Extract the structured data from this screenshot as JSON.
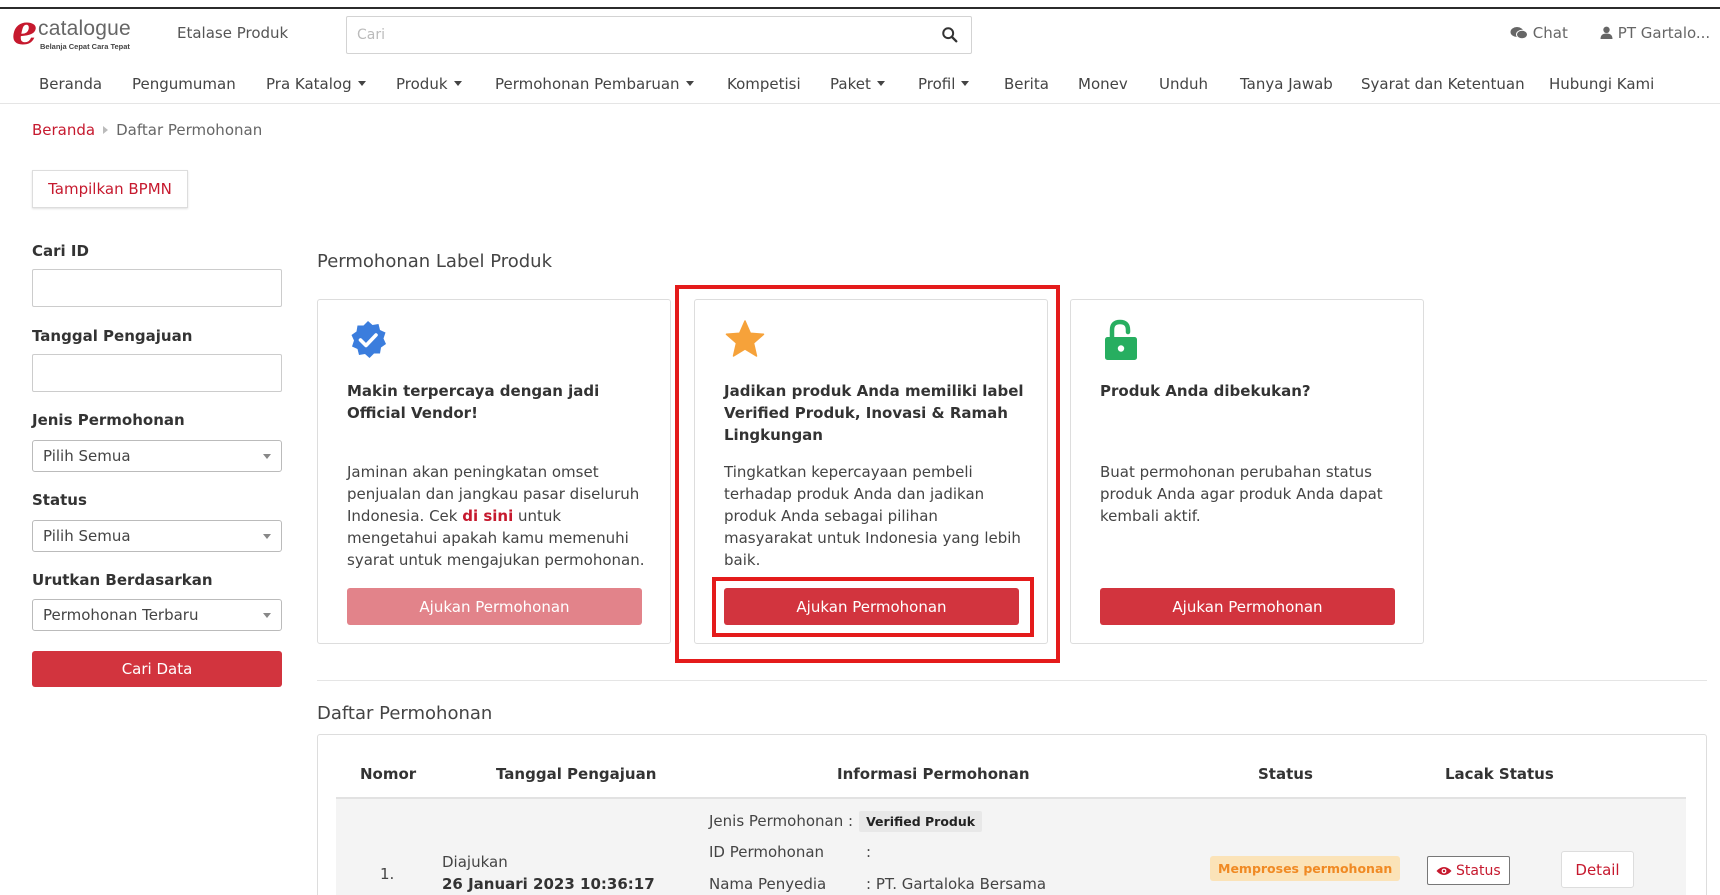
{
  "header": {
    "logo_word": "catalogue",
    "logo_tagline": "Belanja Cepat Cara Tepat",
    "etalase": "Etalase Produk",
    "search_placeholder": "Cari",
    "chat": "Chat",
    "user": "PT Gartalo..."
  },
  "nav": [
    {
      "label": "Beranda",
      "dropdown": false
    },
    {
      "label": "Pengumuman",
      "dropdown": false
    },
    {
      "label": "Pra Katalog",
      "dropdown": true
    },
    {
      "label": "Produk",
      "dropdown": true
    },
    {
      "label": "Permohonan Pembaruan",
      "dropdown": true
    },
    {
      "label": "Kompetisi",
      "dropdown": false
    },
    {
      "label": "Paket",
      "dropdown": true
    },
    {
      "label": "Profil",
      "dropdown": true
    },
    {
      "label": "Berita",
      "dropdown": false
    },
    {
      "label": "Monev",
      "dropdown": false
    },
    {
      "label": "Unduh",
      "dropdown": false
    },
    {
      "label": "Tanya Jawab",
      "dropdown": false
    },
    {
      "label": "Syarat dan Ketentuan",
      "dropdown": false
    },
    {
      "label": "Hubungi Kami",
      "dropdown": false
    }
  ],
  "breadcrumb": {
    "home": "Beranda",
    "current": "Daftar Permohonan"
  },
  "bpmn_button": "Tampilkan BPMN",
  "filters": {
    "cari_id_label": "Cari ID",
    "tanggal_label": "Tanggal Pengajuan",
    "jenis_label": "Jenis Permohonan",
    "jenis_value": "Pilih Semua",
    "status_label": "Status",
    "status_value": "Pilih Semua",
    "urut_label": "Urutkan Berdasarkan",
    "urut_value": "Permohonan Terbaru",
    "submit": "Cari Data"
  },
  "label_section": {
    "title": "Permohonan Label Produk",
    "cards": [
      {
        "icon": "verified-badge-icon",
        "title": "Makin terpercaya dengan jadi Official Vendor!",
        "desc_before": "Jaminan akan peningkatan omset penjualan dan jangkau pasar diseluruh Indonesia. Cek ",
        "desc_link": "di sini",
        "desc_after": " untuk mengetahui apakah kamu memenuhi syarat untuk mengajukan permohonan.",
        "button": "Ajukan Permohonan"
      },
      {
        "icon": "star-icon",
        "title": "Jadikan produk Anda memiliki label Verified Produk, Inovasi & Ramah Lingkungan",
        "desc": "Tingkatkan kepercayaan pembeli terhadap produk Anda dan jadikan produk Anda sebagai pilihan masyarakat untuk Indonesia yang lebih baik.",
        "button": "Ajukan Permohonan"
      },
      {
        "icon": "unlock-icon",
        "title": "Produk Anda dibekukan?",
        "desc": "Buat permohonan perubahan status produk Anda agar produk Anda dapat kembali aktif.",
        "button": "Ajukan Permohonan"
      }
    ]
  },
  "list": {
    "title": "Daftar Permohonan",
    "headers": [
      "Nomor",
      "Tanggal Pengajuan",
      "Informasi Permohonan",
      "Status",
      "Lacak Status"
    ],
    "rows": [
      {
        "nomor": "1.",
        "tanggal_label": "Diajukan",
        "tanggal": "26 Januari 2023 10:36:17",
        "jenis_key": "Jenis Permohonan :",
        "jenis_value": "Verified Produk",
        "id_key": "ID Permohonan",
        "id_sep": ":",
        "penyedia_key": "Nama Penyedia",
        "penyedia_value": ": PT. Gartaloka Bersama",
        "status": "Memproses permohonan",
        "lacak": "Status",
        "detail": "Detail"
      }
    ]
  },
  "colors": {
    "brand_red": "#c6192e",
    "button_red": "#d2343e",
    "highlight_red": "#e41b1b",
    "verified_blue": "#3b7ddd",
    "star_orange": "#f6a23a",
    "unlock_green": "#27ae60",
    "status_badge_bg": "#fbe3b8",
    "status_badge_text": "#f08a24"
  }
}
